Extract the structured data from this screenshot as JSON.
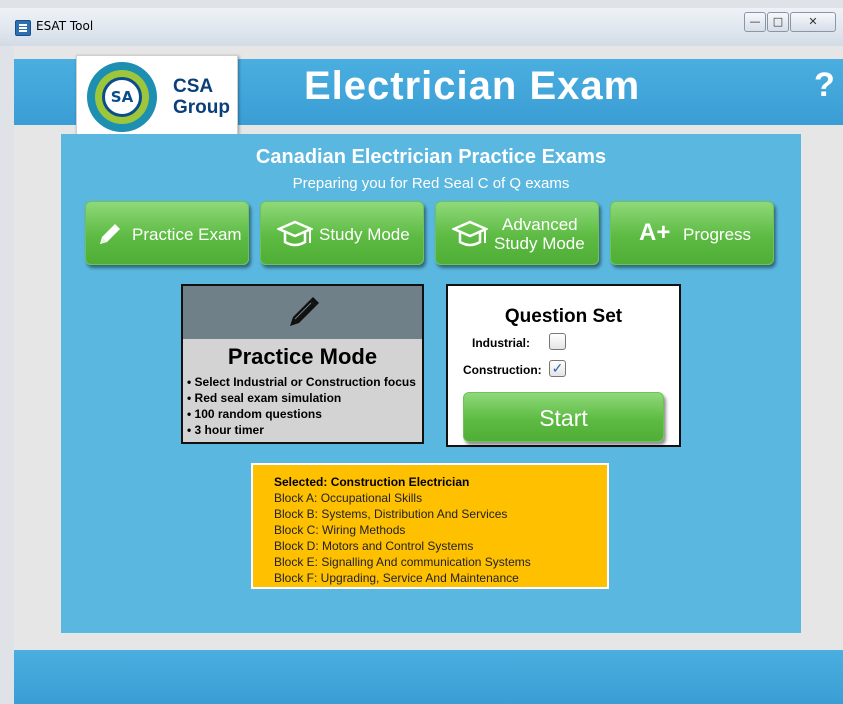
{
  "window": {
    "title": "ESAT Tool",
    "controls": [
      "—",
      "□",
      "✕"
    ]
  },
  "header": {
    "logo_line1": "CSA",
    "logo_line2": "Group",
    "logo_mark": "SA",
    "title": "Electrician Exam",
    "help": "?"
  },
  "panel": {
    "title": "Canadian Electrician Practice Exams",
    "subtitle": "Preparing you for Red Seal C of Q exams"
  },
  "mode_buttons": [
    {
      "label": "Practice Exam",
      "icon": "pencil-icon"
    },
    {
      "label": "Study Mode",
      "icon": "graduation-cap-icon"
    },
    {
      "label_line1": "Advanced",
      "label_line2": "Study Mode",
      "icon": "graduation-cap-icon"
    },
    {
      "label": "Progress",
      "icon": "a-plus-icon",
      "icon_text": "A+"
    }
  ],
  "mode_card": {
    "name": "Practice Mode",
    "features": [
      "• Select Industrial or Construction focus",
      "• Red seal exam simulation",
      "• 100 random questions",
      "• 3 hour timer"
    ]
  },
  "question_set": {
    "title": "Question Set",
    "industrial_label": "Industrial:",
    "industrial_checked": false,
    "construction_label": "Construction:",
    "construction_checked": true,
    "check_mark": "✓",
    "start_label": "Start"
  },
  "selection": {
    "heading": "Selected: Construction Electrician",
    "blocks": [
      "Block A: Occupational Skills",
      "Block B: Systems, Distribution And Services",
      "Block C: Wiring Methods",
      "Block D: Motors and Control Systems",
      "Block E: Signalling And communication Systems",
      "Block F: Upgrading, Service And Maintenance"
    ]
  },
  "colors": {
    "header_blue": "#3ea3d8",
    "panel_blue": "#5ab7df",
    "button_green": "#5dbb43",
    "info_orange": "#ffc000"
  }
}
